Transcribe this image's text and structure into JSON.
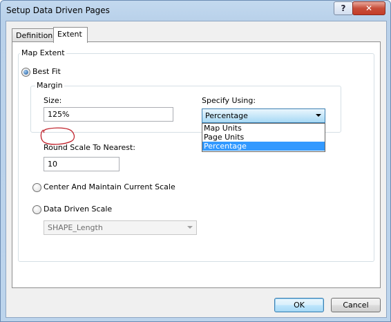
{
  "window": {
    "title": "Setup Data Driven Pages",
    "help_label": "?",
    "close_label": "✕"
  },
  "tabs": [
    {
      "label": "Definition"
    },
    {
      "label": "Extent"
    }
  ],
  "map_extent": {
    "group_label": "Map Extent",
    "best_fit": {
      "label": "Best Fit",
      "selected": true
    },
    "margin": {
      "group_label": "Margin",
      "size_label": "Size:",
      "size_value": "125%",
      "specify_using_label": "Specify Using:",
      "specify_using_value": "Percentage",
      "options": [
        "Map Units",
        "Page Units",
        "Percentage"
      ]
    },
    "round_scale_label": "Round Scale To Nearest:",
    "round_scale_value": "10",
    "center_scale": {
      "label": "Center And Maintain Current Scale",
      "selected": false
    },
    "data_driven_scale": {
      "label": "Data Driven Scale",
      "selected": false,
      "field_value": "SHAPE_Length"
    }
  },
  "buttons": {
    "ok": "OK",
    "cancel": "Cancel"
  },
  "colors": {
    "annotation": "#c0202a",
    "selection": "#3399ff"
  }
}
